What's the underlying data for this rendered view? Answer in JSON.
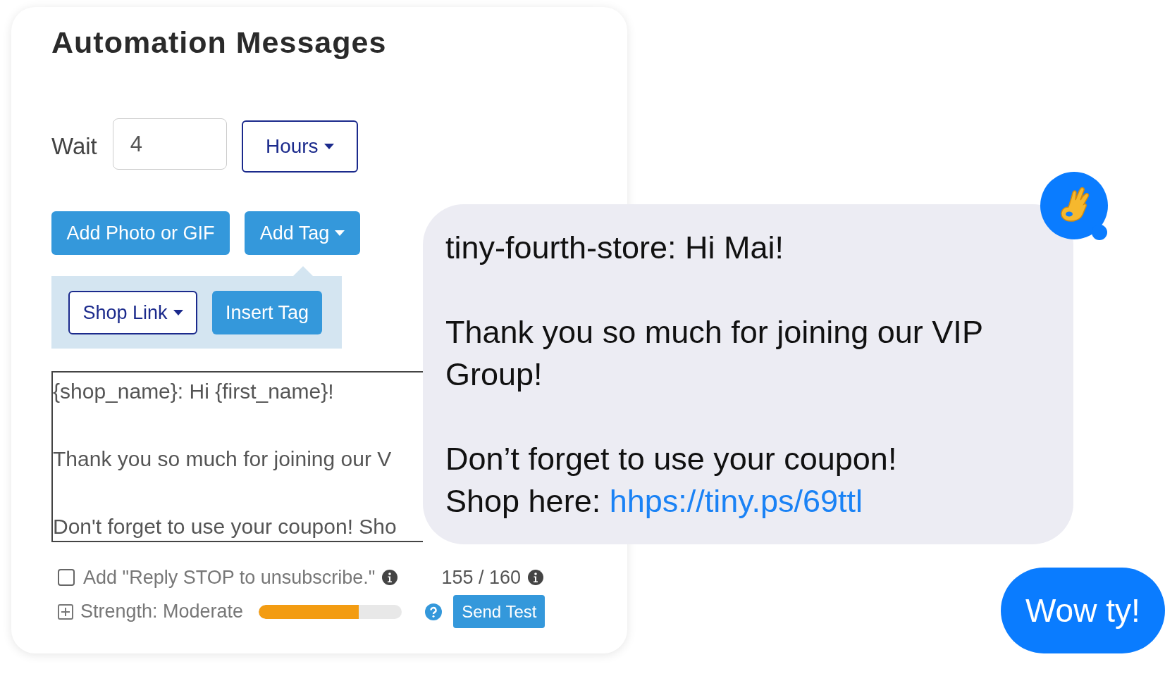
{
  "card": {
    "title": "Automation Messages",
    "wait": {
      "label": "Wait",
      "value": "4",
      "unit": "Hours"
    },
    "buttons": [
      {
        "label": "Add Photo or GIF",
        "kind": "plain"
      },
      {
        "label": "Add Tag",
        "kind": "dropdown",
        "expanded": true
      }
    ],
    "tag_panel": {
      "shop_link": "Shop Link",
      "insert": "Insert Tag"
    },
    "message_lines": [
      "{shop_name}: Hi {first_name}!",
      "Thank you so much for joining our V",
      "Don't forget to use your coupon! Sho"
    ],
    "stop_option": {
      "label": "Add \"Reply STOP to unsubscribe.\"",
      "checked": false
    },
    "counter": "155 / 160",
    "strength": {
      "label": "Strength: Moderate",
      "level": 0.7
    },
    "send_test": "Send Test"
  },
  "preview": {
    "paragraphs": [
      [
        "tiny-fourth-store: Hi Mai!"
      ],
      [
        "Thank you so much for joining our VIP Group!"
      ],
      [
        "Don’t forget to use your coupon!"
      ]
    ],
    "shop_line": {
      "text": "Shop here: ",
      "link": "hhps://tiny.ps/69ttl"
    }
  },
  "reply": "Wow ty!"
}
